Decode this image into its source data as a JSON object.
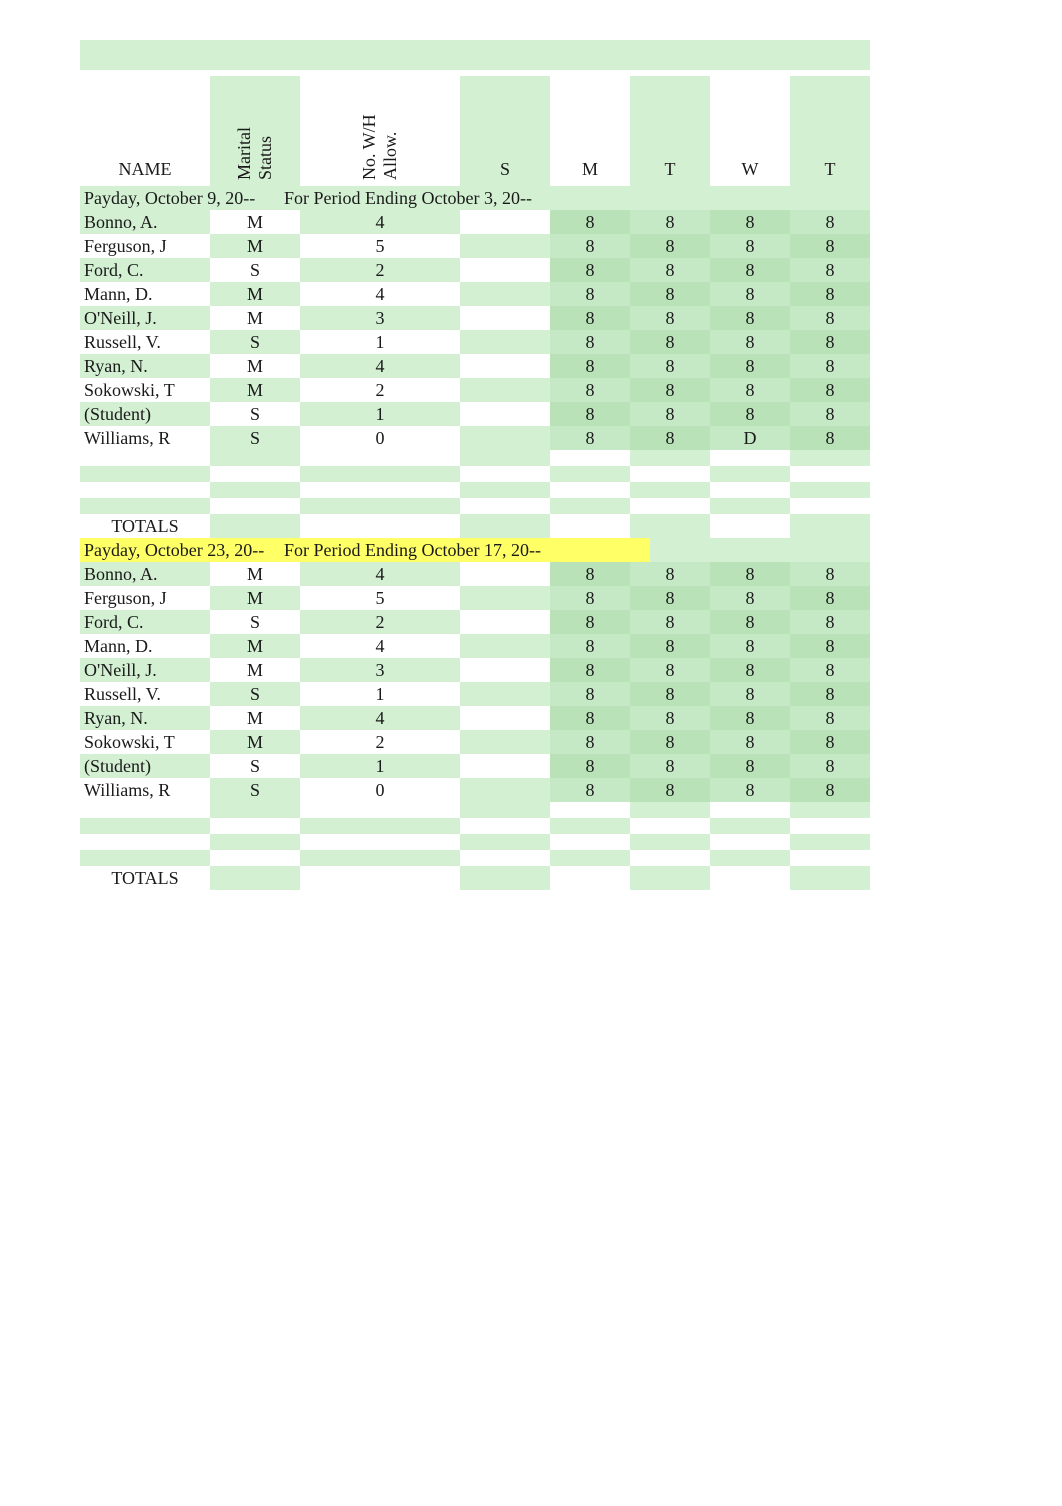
{
  "headers": {
    "name": "NAME",
    "marital_status": "Marital Status",
    "wh_allow": "No. W/H Allow.",
    "s": "S",
    "m": "M",
    "t1": "T",
    "w": "W",
    "t2": "T"
  },
  "sections": [
    {
      "payday_label": "Payday, October 9, 20--",
      "period_label": "For Period Ending October 3, 20--",
      "highlight": false,
      "rows": [
        {
          "name": "Bonno, A.",
          "ms": "M",
          "wh": "4",
          "s": "",
          "m": "8",
          "t1": "8",
          "w": "8",
          "t2": "8"
        },
        {
          "name": "Ferguson, J",
          "ms": "M",
          "wh": "5",
          "s": "",
          "m": "8",
          "t1": "8",
          "w": "8",
          "t2": "8"
        },
        {
          "name": "Ford, C.",
          "ms": "S",
          "wh": "2",
          "s": "",
          "m": "8",
          "t1": "8",
          "w": "8",
          "t2": "8"
        },
        {
          "name": "Mann, D.",
          "ms": "M",
          "wh": "4",
          "s": "",
          "m": "8",
          "t1": "8",
          "w": "8",
          "t2": "8"
        },
        {
          "name": "O'Neill, J.",
          "ms": "M",
          "wh": "3",
          "s": "",
          "m": "8",
          "t1": "8",
          "w": "8",
          "t2": "8"
        },
        {
          "name": "Russell, V.",
          "ms": "S",
          "wh": "1",
          "s": "",
          "m": "8",
          "t1": "8",
          "w": "8",
          "t2": "8"
        },
        {
          "name": "Ryan, N.",
          "ms": "M",
          "wh": "4",
          "s": "",
          "m": "8",
          "t1": "8",
          "w": "8",
          "t2": "8"
        },
        {
          "name": "Sokowski, T",
          "ms": "M",
          "wh": "2",
          "s": "",
          "m": "8",
          "t1": "8",
          "w": "8",
          "t2": "8"
        },
        {
          "name": "(Student)",
          "ms": "S",
          "wh": "1",
          "s": "",
          "m": "8",
          "t1": "8",
          "w": "8",
          "t2": "8"
        },
        {
          "name": "Williams, R",
          "ms": "S",
          "wh": "0",
          "s": "",
          "m": "8",
          "t1": "8",
          "w": "D",
          "t2": "8"
        }
      ],
      "totals_label": "TOTALS"
    },
    {
      "payday_label": "Payday, October 23, 20--",
      "period_label": "For Period Ending October 17, 20--",
      "highlight": true,
      "rows": [
        {
          "name": "Bonno, A.",
          "ms": "M",
          "wh": "4",
          "s": "",
          "m": "8",
          "t1": "8",
          "w": "8",
          "t2": "8"
        },
        {
          "name": "Ferguson, J",
          "ms": "M",
          "wh": "5",
          "s": "",
          "m": "8",
          "t1": "8",
          "w": "8",
          "t2": "8"
        },
        {
          "name": "Ford, C.",
          "ms": "S",
          "wh": "2",
          "s": "",
          "m": "8",
          "t1": "8",
          "w": "8",
          "t2": "8"
        },
        {
          "name": "Mann, D.",
          "ms": "M",
          "wh": "4",
          "s": "",
          "m": "8",
          "t1": "8",
          "w": "8",
          "t2": "8"
        },
        {
          "name": "O'Neill, J.",
          "ms": "M",
          "wh": "3",
          "s": "",
          "m": "8",
          "t1": "8",
          "w": "8",
          "t2": "8"
        },
        {
          "name": "Russell, V.",
          "ms": "S",
          "wh": "1",
          "s": "",
          "m": "8",
          "t1": "8",
          "w": "8",
          "t2": "8"
        },
        {
          "name": "Ryan, N.",
          "ms": "M",
          "wh": "4",
          "s": "",
          "m": "8",
          "t1": "8",
          "w": "8",
          "t2": "8"
        },
        {
          "name": "Sokowski, T",
          "ms": "M",
          "wh": "2",
          "s": "",
          "m": "8",
          "t1": "8",
          "w": "8",
          "t2": "8"
        },
        {
          "name": "(Student)",
          "ms": "S",
          "wh": "1",
          "s": "",
          "m": "8",
          "t1": "8",
          "w": "8",
          "t2": "8"
        },
        {
          "name": "Williams, R",
          "ms": "S",
          "wh": "0",
          "s": "",
          "m": "8",
          "t1": "8",
          "w": "8",
          "t2": "8"
        }
      ],
      "totals_label": "TOTALS"
    }
  ]
}
